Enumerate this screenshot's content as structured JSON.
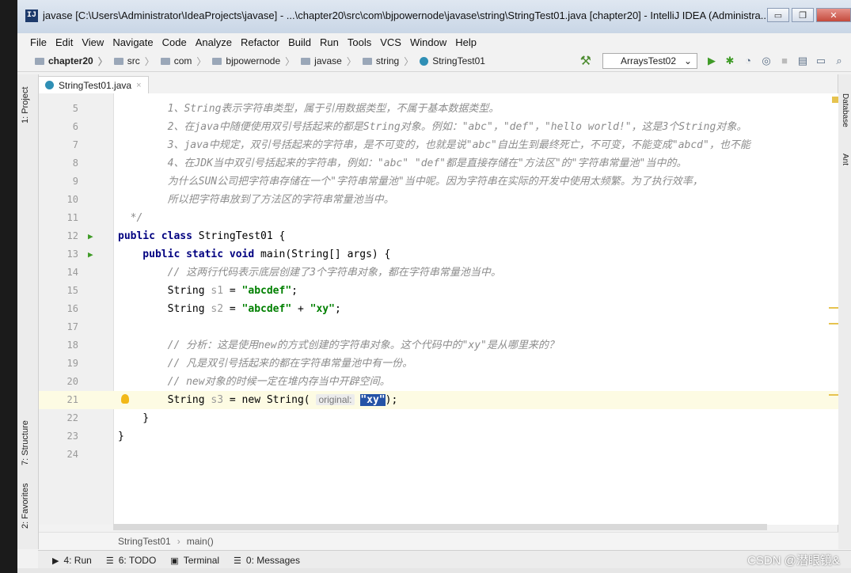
{
  "window": {
    "title": "javase [C:\\Users\\Administrator\\IdeaProjects\\javase] - ...\\chapter20\\src\\com\\bjpowernode\\javase\\string\\StringTest01.java [chapter20] - IntelliJ IDEA (Administra...",
    "app_icon": "IJ",
    "minimize": "▭",
    "maximize": "❐",
    "close": "✕"
  },
  "menu": [
    "File",
    "Edit",
    "View",
    "Navigate",
    "Code",
    "Analyze",
    "Refactor",
    "Build",
    "Run",
    "Tools",
    "VCS",
    "Window",
    "Help"
  ],
  "breadcrumbs": [
    "chapter20",
    "src",
    "com",
    "bjpowernode",
    "javase",
    "string",
    "StringTest01"
  ],
  "run_config": "ArraysTest02",
  "tab": {
    "label": "StringTest01.java",
    "close": "×"
  },
  "left_tools": [
    "1: Project",
    "7: Structure",
    "2: Favorites"
  ],
  "right_tools": [
    "Database",
    "Ant"
  ],
  "code_lines": [
    {
      "n": "5",
      "parts": [
        {
          "t": "        1、String表示字符串类型，属于引用数据类型，不属于基本数据类型。",
          "c": "cm"
        }
      ]
    },
    {
      "n": "6",
      "parts": [
        {
          "t": "        2、在java中随便使用双引号括起来的都是String对象。例如：\"abc\"，\"def\"，\"hello world!\"，这是3个String对象。",
          "c": "cm"
        }
      ]
    },
    {
      "n": "7",
      "parts": [
        {
          "t": "        3、java中规定，双引号括起来的字符串，是不可变的，也就是说\"abc\"自出生到最终死亡，不可变，不能变成\"abcd\"，也不能",
          "c": "cm"
        }
      ]
    },
    {
      "n": "8",
      "parts": [
        {
          "t": "        4、在JDK当中双引号括起来的字符串，例如：\"abc\" \"def\"都是直接存储在\"方法区\"的\"字符串常量池\"当中的。",
          "c": "cm"
        }
      ]
    },
    {
      "n": "9",
      "parts": [
        {
          "t": "        为什么SUN公司把字符串存储在一个\"字符串常量池\"当中呢。因为字符串在实际的开发中使用太频繁。为了执行效率，",
          "c": "cm"
        }
      ]
    },
    {
      "n": "10",
      "parts": [
        {
          "t": "        所以把字符串放到了方法区的字符串常量池当中。",
          "c": "cm"
        }
      ]
    },
    {
      "n": "11",
      "parts": [
        {
          "t": "  */",
          "c": "cm"
        }
      ]
    },
    {
      "n": "12",
      "run": true,
      "parts": [
        {
          "t": "public class ",
          "c": "kw"
        },
        {
          "t": "StringTest01 {",
          "c": ""
        }
      ]
    },
    {
      "n": "13",
      "run": true,
      "parts": [
        {
          "t": "    public static void ",
          "c": "kw"
        },
        {
          "t": "main(String[] args) {",
          "c": ""
        }
      ]
    },
    {
      "n": "14",
      "parts": [
        {
          "t": "        // 这两行代码表示底层创建了3个字符串对象，都在字符串常量池当中。",
          "c": "cm"
        }
      ]
    },
    {
      "n": "15",
      "parts": [
        {
          "t": "        String ",
          "c": ""
        },
        {
          "t": "s1",
          "c": "var"
        },
        {
          "t": " = ",
          "c": ""
        },
        {
          "t": "\"abcdef\"",
          "c": "str"
        },
        {
          "t": ";",
          "c": ""
        }
      ]
    },
    {
      "n": "16",
      "parts": [
        {
          "t": "        String ",
          "c": ""
        },
        {
          "t": "s2",
          "c": "var"
        },
        {
          "t": " = ",
          "c": ""
        },
        {
          "t": "\"abcdef\"",
          "c": "str"
        },
        {
          "t": " + ",
          "c": ""
        },
        {
          "t": "\"xy\"",
          "c": "str"
        },
        {
          "t": ";",
          "c": ""
        }
      ]
    },
    {
      "n": "17",
      "parts": []
    },
    {
      "n": "18",
      "parts": [
        {
          "t": "        // 分析：这是使用new的方式创建的字符串对象。这个代码中的\"xy\"是从哪里来的？",
          "c": "cm"
        }
      ]
    },
    {
      "n": "19",
      "parts": [
        {
          "t": "        // 凡是双引号括起来的都在字符串常量池中有一份。",
          "c": "cm"
        }
      ]
    },
    {
      "n": "20",
      "parts": [
        {
          "t": "        // new对象的时候一定在堆内存当中开辟空间。",
          "c": "cm"
        }
      ]
    },
    {
      "n": "21",
      "cur": true,
      "bulb": true,
      "parts": [
        {
          "t": "        String ",
          "c": ""
        },
        {
          "t": "s3",
          "c": "var"
        },
        {
          "t": " = new String( ",
          "c": ""
        },
        {
          "t": "original:",
          "c": "hint"
        },
        {
          "t": " ",
          "c": ""
        },
        {
          "t": "\"xy\"",
          "c": "sel"
        },
        {
          "t": ");",
          "c": ""
        }
      ]
    },
    {
      "n": "22",
      "parts": [
        {
          "t": "    }",
          "c": ""
        }
      ]
    },
    {
      "n": "23",
      "parts": [
        {
          "t": "}",
          "c": ""
        }
      ]
    },
    {
      "n": "24",
      "parts": []
    }
  ],
  "editor_breadcrumb": [
    "StringTest01",
    "main()"
  ],
  "bottom_tools": [
    {
      "icon": "▶",
      "label": "4: Run"
    },
    {
      "icon": "☰",
      "label": "6: TODO"
    },
    {
      "icon": "▣",
      "label": "Terminal"
    },
    {
      "icon": "☰",
      "label": "0: Messages"
    }
  ],
  "watermark": "CSDN @潜眼镜&"
}
